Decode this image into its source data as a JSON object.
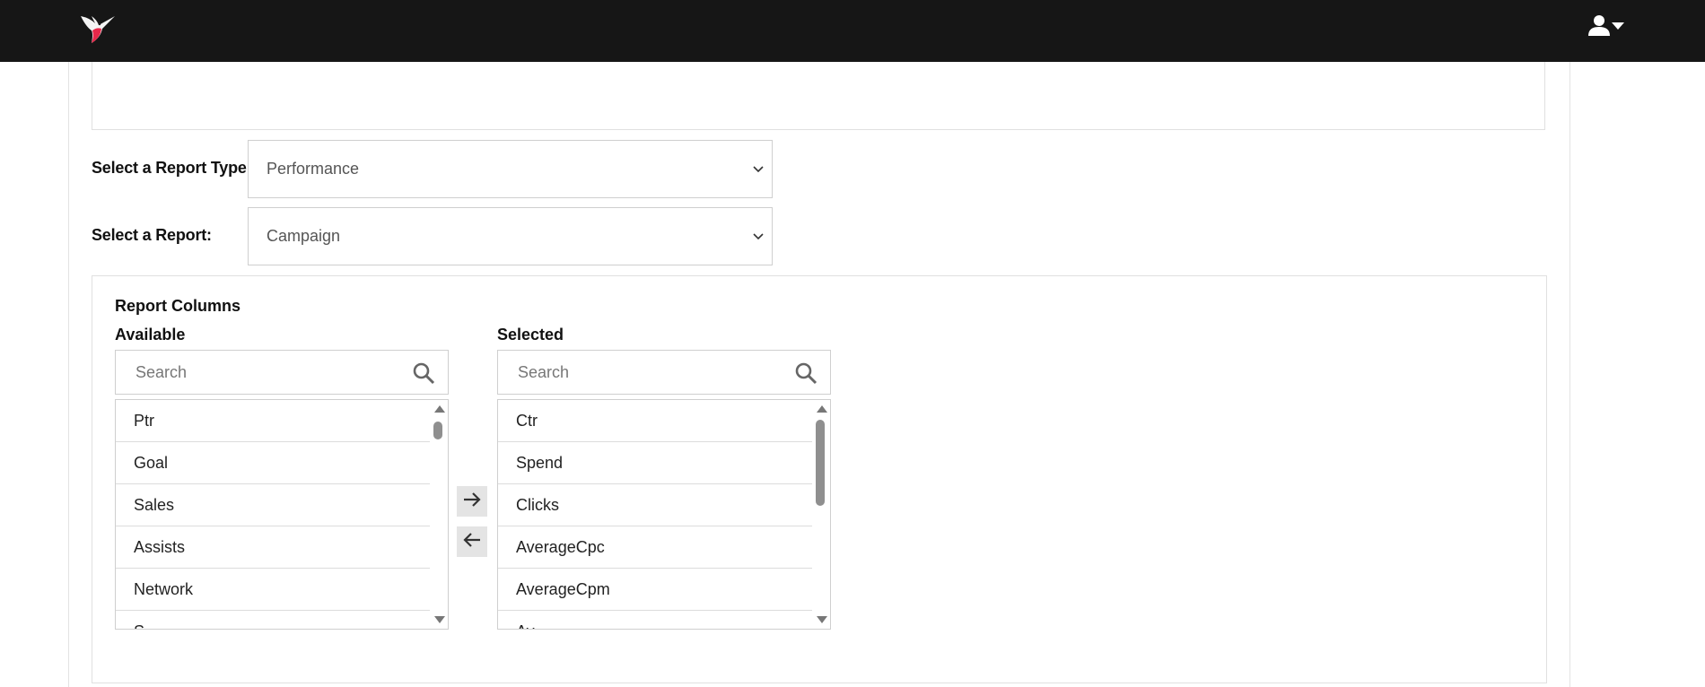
{
  "header": {
    "logo_icon": "hummingbird-logo-icon",
    "user_icon": "user-icon",
    "user_menu_caret": "caret-down-icon",
    "brand_color": "#e8284a",
    "bar_color": "#161616"
  },
  "report_form": {
    "report_type_label": "Select a Report Type:",
    "report_type_value": "Performance",
    "report_label": "Select a Report:",
    "report_value": "Campaign"
  },
  "report_columns": {
    "title": "Report Columns",
    "available": {
      "heading": "Available",
      "search_placeholder": "Search",
      "items": [
        "Ptr",
        "Goal",
        "Sales",
        "Assists",
        "Network",
        "S"
      ]
    },
    "selected": {
      "heading": "Selected",
      "search_placeholder": "Search",
      "items": [
        "Ctr",
        "Spend",
        "Clicks",
        "AverageCpc",
        "AverageCpm",
        "Av"
      ]
    },
    "add_button_icon": "arrow-right-icon",
    "remove_button_icon": "arrow-left-icon"
  }
}
